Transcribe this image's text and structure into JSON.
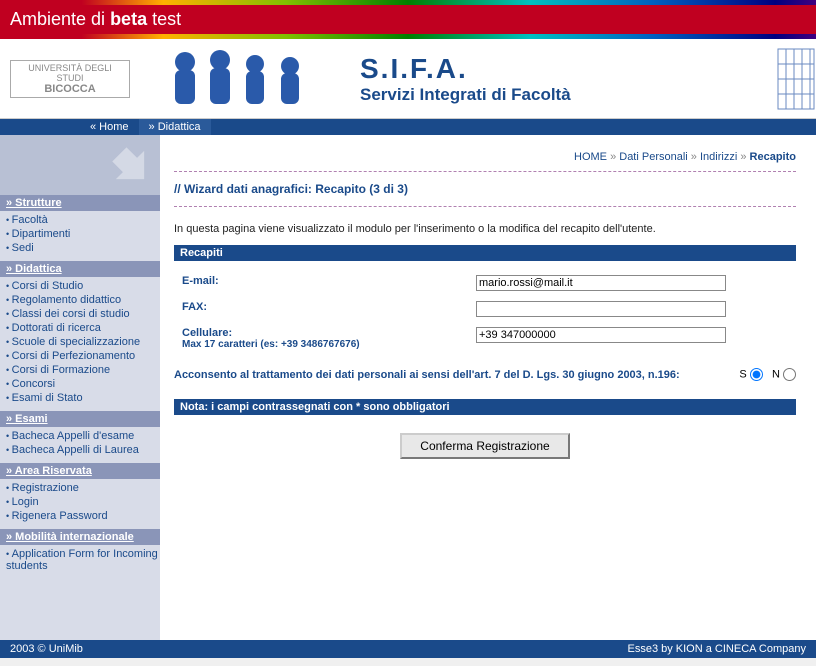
{
  "env_bar": {
    "prefix": "Ambiente di ",
    "bold": "beta",
    "suffix": " test"
  },
  "logo": {
    "line1": "UNIVERSITÀ DEGLI STUDI",
    "line2": "BICOCCA"
  },
  "sifa": {
    "title": "S.I.F.A.",
    "subtitle": "Servizi Integrati di Facoltà"
  },
  "topnav": {
    "home": "« Home",
    "didattica": "» Didattica"
  },
  "sidebar": {
    "sections": [
      {
        "title": "» Strutture",
        "items": [
          "Facoltà",
          "Dipartimenti",
          "Sedi"
        ]
      },
      {
        "title": "» Didattica",
        "items": [
          "Corsi di Studio",
          "Regolamento didattico",
          "Classi dei corsi di studio",
          "Dottorati di ricerca",
          "Scuole di specializzazione",
          "Corsi di Perfezionamento",
          "Corsi di Formazione",
          "Concorsi",
          "Esami di Stato"
        ]
      },
      {
        "title": "» Esami",
        "items": [
          "Bacheca Appelli d'esame",
          "Bacheca Appelli di Laurea"
        ]
      },
      {
        "title": "» Area Riservata",
        "items": [
          "Registrazione",
          "Login",
          "Rigenera Password"
        ]
      },
      {
        "title": "» Mobilità internazionale",
        "items": [
          "Application Form for Incoming students"
        ]
      }
    ]
  },
  "breadcrumb": {
    "home": "HOME",
    "l1": "Dati Personali",
    "l2": "Indirizzi",
    "current": "Recapito",
    "sep": " » "
  },
  "page": {
    "title": "// Wizard dati anagrafici: Recapito (3 di 3)",
    "intro": "In questa pagina viene visualizzato il modulo per l'inserimento o la modifica del recapito dell'utente.",
    "band_recapiti": "Recapiti",
    "form": {
      "email_label": "E-mail:",
      "email_value": "mario.rossi@mail.it",
      "fax_label": "FAX:",
      "fax_value": "",
      "cell_label": "Cellulare:",
      "cell_hint": "Max 17 caratteri (es: +39 3486767676)",
      "cell_value": "+39 347000000"
    },
    "consent_text": "Acconsento al trattamento dei dati personali ai sensi dell'art. 7 del D. Lgs. 30 giugno 2003, n.196:",
    "consent_s": "S",
    "consent_n": "N",
    "band_note": "Nota: i campi contrassegnati con * sono obbligatori",
    "submit": "Conferma Registrazione"
  },
  "footer": {
    "left": "2003 © UniMib",
    "right": "Esse3 by KION a CINECA Company"
  }
}
